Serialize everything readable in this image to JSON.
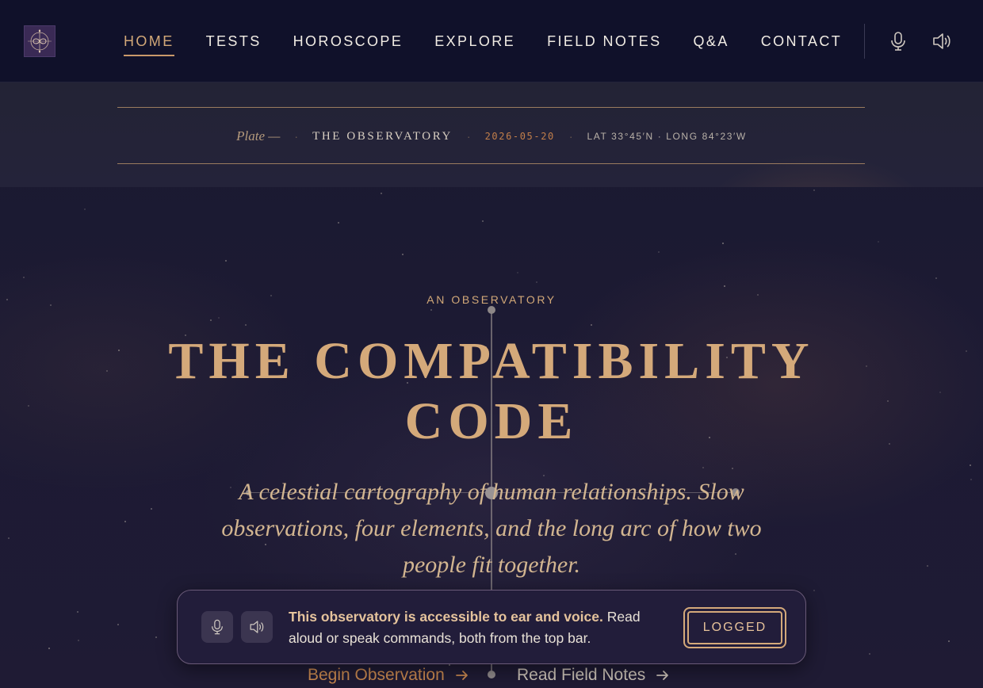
{
  "header": {
    "nav": [
      {
        "label": "HOME",
        "active": true
      },
      {
        "label": "TESTS"
      },
      {
        "label": "HOROSCOPE"
      },
      {
        "label": "EXPLORE"
      },
      {
        "label": "FIELD NOTES"
      },
      {
        "label": "Q&A"
      },
      {
        "label": "CONTACT"
      }
    ],
    "icons": [
      "logo-infinity-compass-icon",
      "microphone-icon",
      "speaker-icon"
    ]
  },
  "plate": {
    "prefix": "Plate —",
    "name": "THE OBSERVATORY",
    "date": "2026-05-20",
    "coords": "LAT 33°45′N · LONG 84°23′W"
  },
  "hero": {
    "eyebrow": "AN OBSERVATORY",
    "title_line1": "THE COMPATIBILITY",
    "title_line2": "CODE",
    "subtitle": "A celestial cartography of human relationships. Slow observations, four elements, and the long arc of how two people fit together."
  },
  "accessibility_banner": {
    "bold_text": "This observatory is accessible to ear and voice.",
    "text": "Read aloud or speak commands, both from the top bar.",
    "button_label": "LOGGED",
    "icons": [
      "microphone-icon",
      "speaker-icon"
    ]
  },
  "ctas": {
    "primary": "Begin Observation",
    "secondary": "Read Field Notes"
  },
  "colors": {
    "background": "#15142a",
    "header": "#10112a",
    "accent_gold": "#d4a97a",
    "accent_copper": "#c7874f",
    "banner": "#221d3a"
  }
}
